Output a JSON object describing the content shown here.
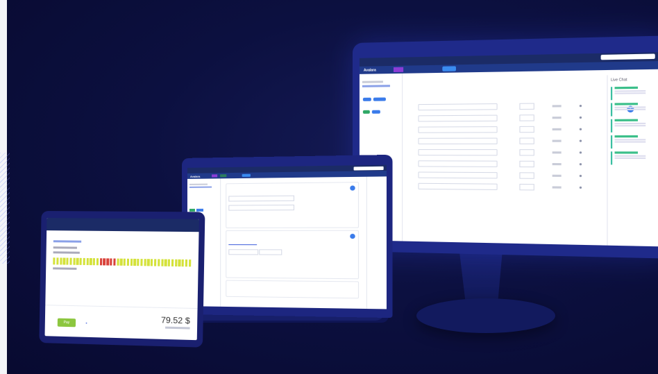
{
  "colors": {
    "background": "#0b0d3a",
    "device_frame": "#1d2680",
    "topbar": "#1b2b66",
    "nav": "#203a8a",
    "active_tab": "#8b3dd6",
    "accent_blue": "#3a7bea",
    "green_button": "#8cc63f",
    "meter_yellow": "#d4e23a",
    "meter_red": "#d9423a"
  },
  "monitor": {
    "logo": "Avalara",
    "right_panel_title": "Live Chat"
  },
  "tablet": {
    "primary_button_label": "Pay",
    "amount": "79.52 $"
  },
  "meter_segments": [
    "y",
    "y",
    "y",
    "y",
    "y",
    "y",
    "y",
    "y",
    "y",
    "y",
    "y",
    "y",
    "y",
    "y",
    "r",
    "r",
    "r",
    "r",
    "r",
    "y",
    "y",
    "y",
    "y",
    "y",
    "y",
    "y",
    "y",
    "y",
    "y",
    "y",
    "y",
    "y",
    "y",
    "y",
    "y",
    "y",
    "y",
    "y",
    "y",
    "y",
    "y"
  ]
}
